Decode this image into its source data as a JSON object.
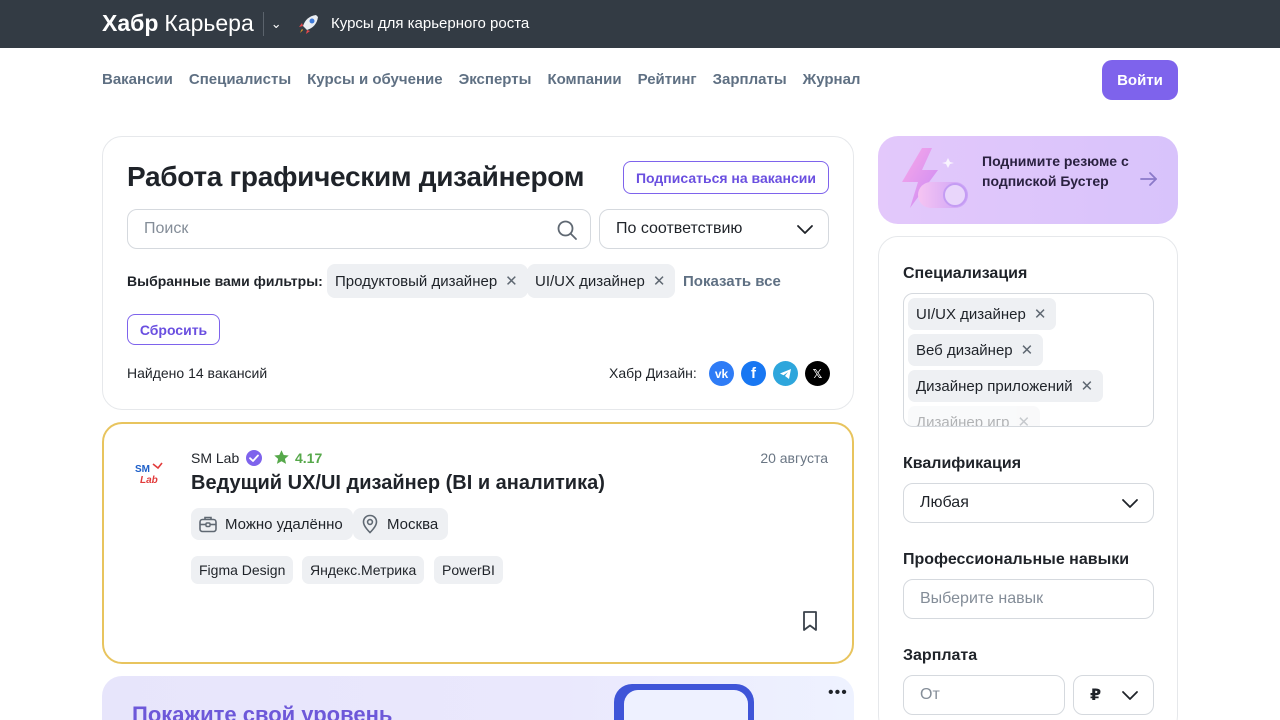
{
  "topbar": {
    "brand_bold": "Хабр",
    "brand_light": "Карьера",
    "courses_link": "Курсы для карьерного роста"
  },
  "nav": {
    "items": [
      "Вакансии",
      "Специалисты",
      "Курсы и обучение",
      "Эксперты",
      "Компании",
      "Рейтинг",
      "Зарплаты",
      "Журнал"
    ],
    "login_label": "Войти"
  },
  "search": {
    "title": "Работа графическим дизайнером",
    "subscribe_label": "Подписаться на вакансии",
    "search_placeholder": "Поиск",
    "sort_value": "По соответствию",
    "filters_label": "Выбранные вами фильтры:",
    "filters": [
      "Продуктовый дизайнер",
      "UI/UX дизайнер"
    ],
    "show_all": "Показать все",
    "reset_label": "Сбросить",
    "found_text": "Найдено 14 вакансий",
    "social_label": "Хабр Дизайн:"
  },
  "vacancy": {
    "company": "SM Lab",
    "rating": "4.17",
    "date": "20 августа",
    "title": "Ведущий UX/UI дизайнер (BI и аналитика)",
    "remote": "Можно удалённо",
    "city": "Москва",
    "skills": [
      "Figma Design",
      "Яндекс.Метрика",
      "PowerBI"
    ]
  },
  "promo": {
    "text": "Покажите свой уровень"
  },
  "boost": {
    "text": "Поднимите резюме с подпиской Бустер"
  },
  "sidebar": {
    "spec_heading": "Специализация",
    "spec_chips": [
      "UI/UX дизайнер",
      "Веб дизайнер",
      "Дизайнер приложений",
      "Дизайнер игр"
    ],
    "qual_heading": "Квалификация",
    "qual_value": "Любая",
    "skills_heading": "Профессиональные навыки",
    "skills_placeholder": "Выберите навык",
    "salary_heading": "Зарплата",
    "salary_placeholder": "От",
    "currency": "₽"
  },
  "colors": {
    "accent": "#7e63ec",
    "topbar": "#333b44",
    "highlight_border": "#e8c45e",
    "rating_green": "#56a84a"
  }
}
